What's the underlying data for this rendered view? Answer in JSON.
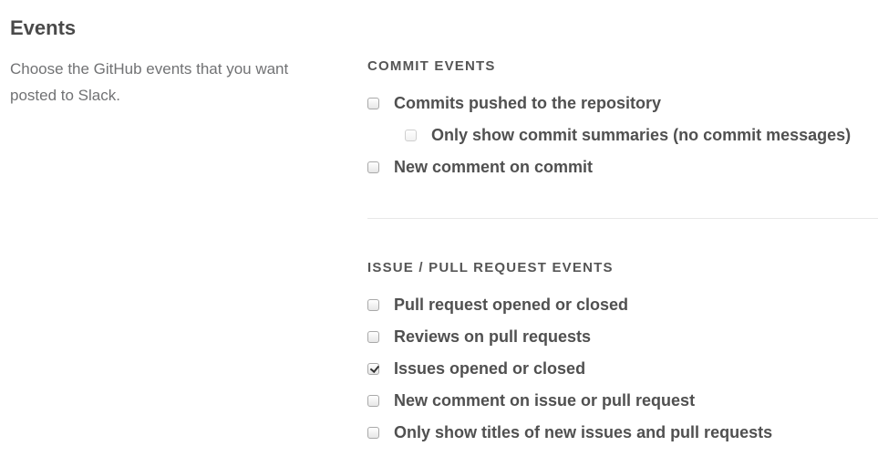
{
  "page": {
    "title": "Events",
    "description": "Choose the GitHub events that you want posted to Slack."
  },
  "commit_section": {
    "heading": "COMMIT EVENTS",
    "options": [
      {
        "label": "Commits pushed to the repository",
        "checked": false,
        "disabled": false
      },
      {
        "label": "Only show commit summaries (no commit messages)",
        "checked": false,
        "disabled": true
      },
      {
        "label": "New comment on commit",
        "checked": false,
        "disabled": false
      }
    ]
  },
  "issue_section": {
    "heading": "ISSUE / PULL REQUEST EVENTS",
    "options": [
      {
        "label": "Pull request opened or closed",
        "checked": false,
        "disabled": false
      },
      {
        "label": "Reviews on pull requests",
        "checked": false,
        "disabled": false
      },
      {
        "label": "Issues opened or closed",
        "checked": true,
        "disabled": false
      },
      {
        "label": "New comment on issue or pull request",
        "checked": false,
        "disabled": false
      },
      {
        "label": "Only show titles of new issues and pull requests",
        "checked": false,
        "disabled": false
      }
    ]
  }
}
